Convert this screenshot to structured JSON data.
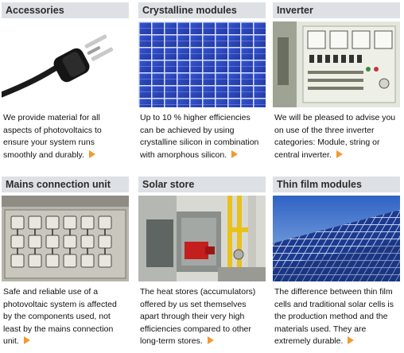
{
  "products": [
    {
      "title": "Accessories",
      "image_subject": "power-plug-image",
      "description": "We provide material for all aspects of photovoltaics to ensure your system runs smoothly and durably.",
      "more_icon": "orange-arrow-icon"
    },
    {
      "title": "Crystalline modules",
      "image_subject": "solar-cell-grid-image",
      "description": "Up to 10 % higher efficiencies can be achieved by using crystalline silicon in combination with amorphous silicon.",
      "more_icon": "orange-arrow-icon"
    },
    {
      "title": "Inverter",
      "image_subject": "inverter-cabinet-image",
      "description": "We will be pleased to advise you on use of the three inverter categories: Module, string or central inverter.",
      "more_icon": "orange-arrow-icon"
    },
    {
      "title": "Mains connection unit",
      "image_subject": "electric-meters-image",
      "description": "Safe and reliable use of a photovoltaic system is affected by the components used, not least by the mains connection unit.",
      "more_icon": "orange-arrow-icon"
    },
    {
      "title": "Solar store",
      "image_subject": "heat-storage-boiler-image",
      "description": "The heat stores (accumulators) offered by us set themselves apart through their very high efficiencies compared to other long-term stores.",
      "more_icon": "orange-arrow-icon"
    },
    {
      "title": "Thin film modules",
      "image_subject": "thin-film-panels-sky-image",
      "description": "The difference between thin film cells and traditional solar cells is the production method and the materials used. They are extremely durable.",
      "more_icon": "orange-arrow-icon"
    }
  ],
  "colors": {
    "header_bg": "#dde1e5",
    "header_text": "#2b2b2b",
    "body_text": "#111111",
    "accent_arrow": "#f19a35"
  }
}
